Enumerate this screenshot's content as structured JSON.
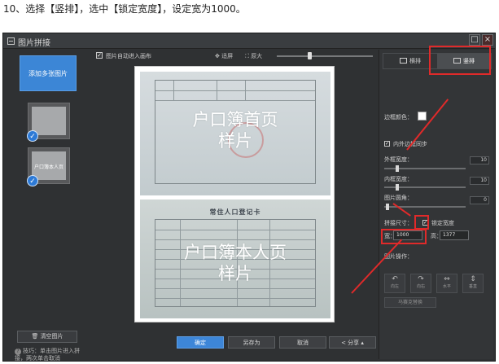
{
  "caption": "10、选择【竖排】，选中【锁定宽度】，设定宽为1000。",
  "window": {
    "title": "图片拼接",
    "min_label": "□",
    "close_label": "×"
  },
  "left": {
    "add_button": "添加多张图片",
    "thumb1_label": "",
    "thumb2_label": "户口簿本人页",
    "clear_button": "清空图片",
    "tip": "技巧：单击图片进入拼接，两次单击取消"
  },
  "toolbar": {
    "auto_fit_label": "图片自动进入画布",
    "fit_label": "适屏",
    "original_label": "原大"
  },
  "canvas": {
    "photo1_text_line1": "户口簿首页",
    "photo1_text_line2": "样片",
    "photo2_header": "常住人口登记卡",
    "photo2_text_line1": "户口簿本人页",
    "photo2_text_line2": "样片"
  },
  "bottom": {
    "ok": "确定",
    "save_as": "另存为",
    "cancel": "取消",
    "share": "分享"
  },
  "right": {
    "tab_horizontal": "横排",
    "tab_vertical": "竖排",
    "border_color_label": "边框颜色：",
    "border_color": "#ffffff",
    "inner_outer_label": "内外边框同步",
    "outer_width_label": "外框宽度：",
    "outer_width_value": "10",
    "inner_width_label": "内框宽度：",
    "inner_width_value": "10",
    "corner_label": "图片圆角：",
    "corner_value": "0",
    "size_label": "拼接尺寸：",
    "lock_width_label": "锁定宽度",
    "width_label": "宽：",
    "width_value": "1000",
    "height_label": "高：",
    "height_value": "1377",
    "ops_label": "图片操作：",
    "op1": "向左",
    "op2": "向右",
    "op3": "水平",
    "op4": "垂直",
    "mosaic": "马赛克替换"
  },
  "colors": {
    "accent": "#3d86d8",
    "annotation": "#e02a2a",
    "window_bg": "#2f3133"
  }
}
